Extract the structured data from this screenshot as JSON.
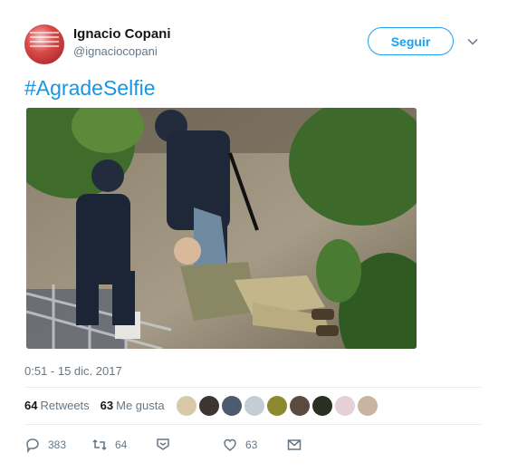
{
  "tweet": {
    "author_name": "Ignacio Copani",
    "author_handle": "@ignaciocopani",
    "follow_label": "Seguir",
    "text": "#AgradeSelfie",
    "timestamp": "0:51 - 15 dic. 2017",
    "retweets_count": "64",
    "retweets_label": "Retweets",
    "likes_count": "63",
    "likes_label": "Me gusta",
    "replies_action_count": "383",
    "retweets_action_count": "64",
    "likes_action_count": "63"
  },
  "colors": {
    "accent": "#1da1f2",
    "link": "#1b95e0",
    "muted": "#657786"
  },
  "icons": [
    "chevron-down-icon",
    "reply-icon",
    "retweet-icon",
    "dm-icon",
    "heart-icon",
    "envelope-icon"
  ]
}
